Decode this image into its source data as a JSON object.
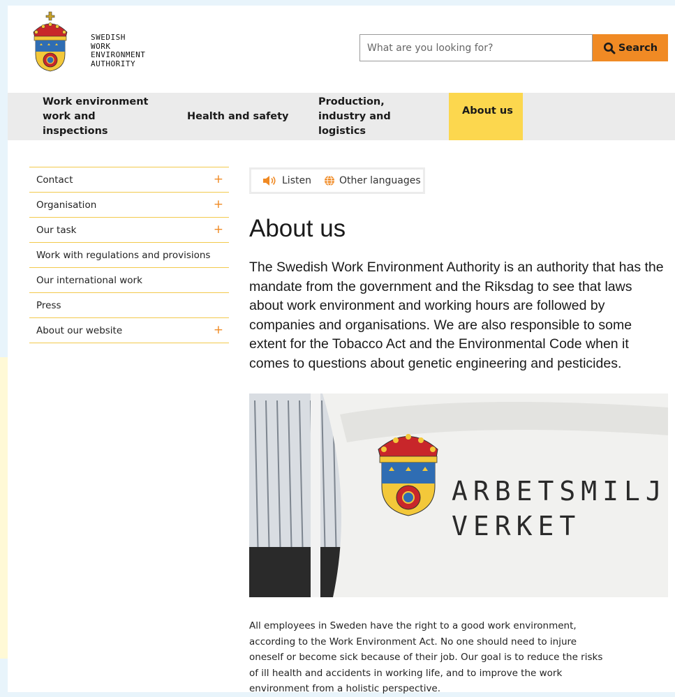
{
  "header": {
    "logo_lines": [
      "SWEDISH",
      "WORK",
      "ENVIRONMENT",
      "AUTHORITY"
    ],
    "search": {
      "placeholder": "What are you looking for?",
      "button_label": "Search"
    }
  },
  "nav": {
    "items": [
      {
        "label": "Work environment work and inspections",
        "active": false
      },
      {
        "label": "Health and safety",
        "active": false
      },
      {
        "label": "Production, industry and logistics",
        "active": false
      },
      {
        "label": "About us",
        "active": true
      }
    ]
  },
  "sidebar": {
    "items": [
      {
        "label": "Contact",
        "expand": "+"
      },
      {
        "label": "Organisation",
        "expand": "+"
      },
      {
        "label": "Our task",
        "expand": "+"
      },
      {
        "label": "Work with regulations and provisions",
        "expand": ""
      },
      {
        "label": "Our international work",
        "expand": ""
      },
      {
        "label": "Press",
        "expand": ""
      },
      {
        "label": "About our website",
        "expand": "+"
      }
    ]
  },
  "toolbar": {
    "listen_label": "Listen",
    "languages_label": "Other languages"
  },
  "main": {
    "title": "About us",
    "intro": "The Swedish Work Environment Authority is an authority that has the mandate from the government and the Riksdag to see that laws about work environment and working hours are followed by companies and organisations. We are also responsible to some extent for the Tobacco Act and the Environmental Code when it comes to questions about genetic engineering and pesticides.",
    "image": {
      "flag_line1": "ARBETSMILJÖ",
      "flag_line2": "VERKET"
    },
    "body": "All employees in Sweden have the right to a good work environment, according to the Work Environment Act. No one should need to injure oneself or become sick because of their job. Our goal is to reduce the risks of ill health and accidents in working life, and to improve the work environment from a holistic perspective."
  },
  "colors": {
    "accent": "#f08a24",
    "nav_active": "#fcd74e",
    "divider": "#f2c94c",
    "nav_bg": "#ebebeb"
  }
}
